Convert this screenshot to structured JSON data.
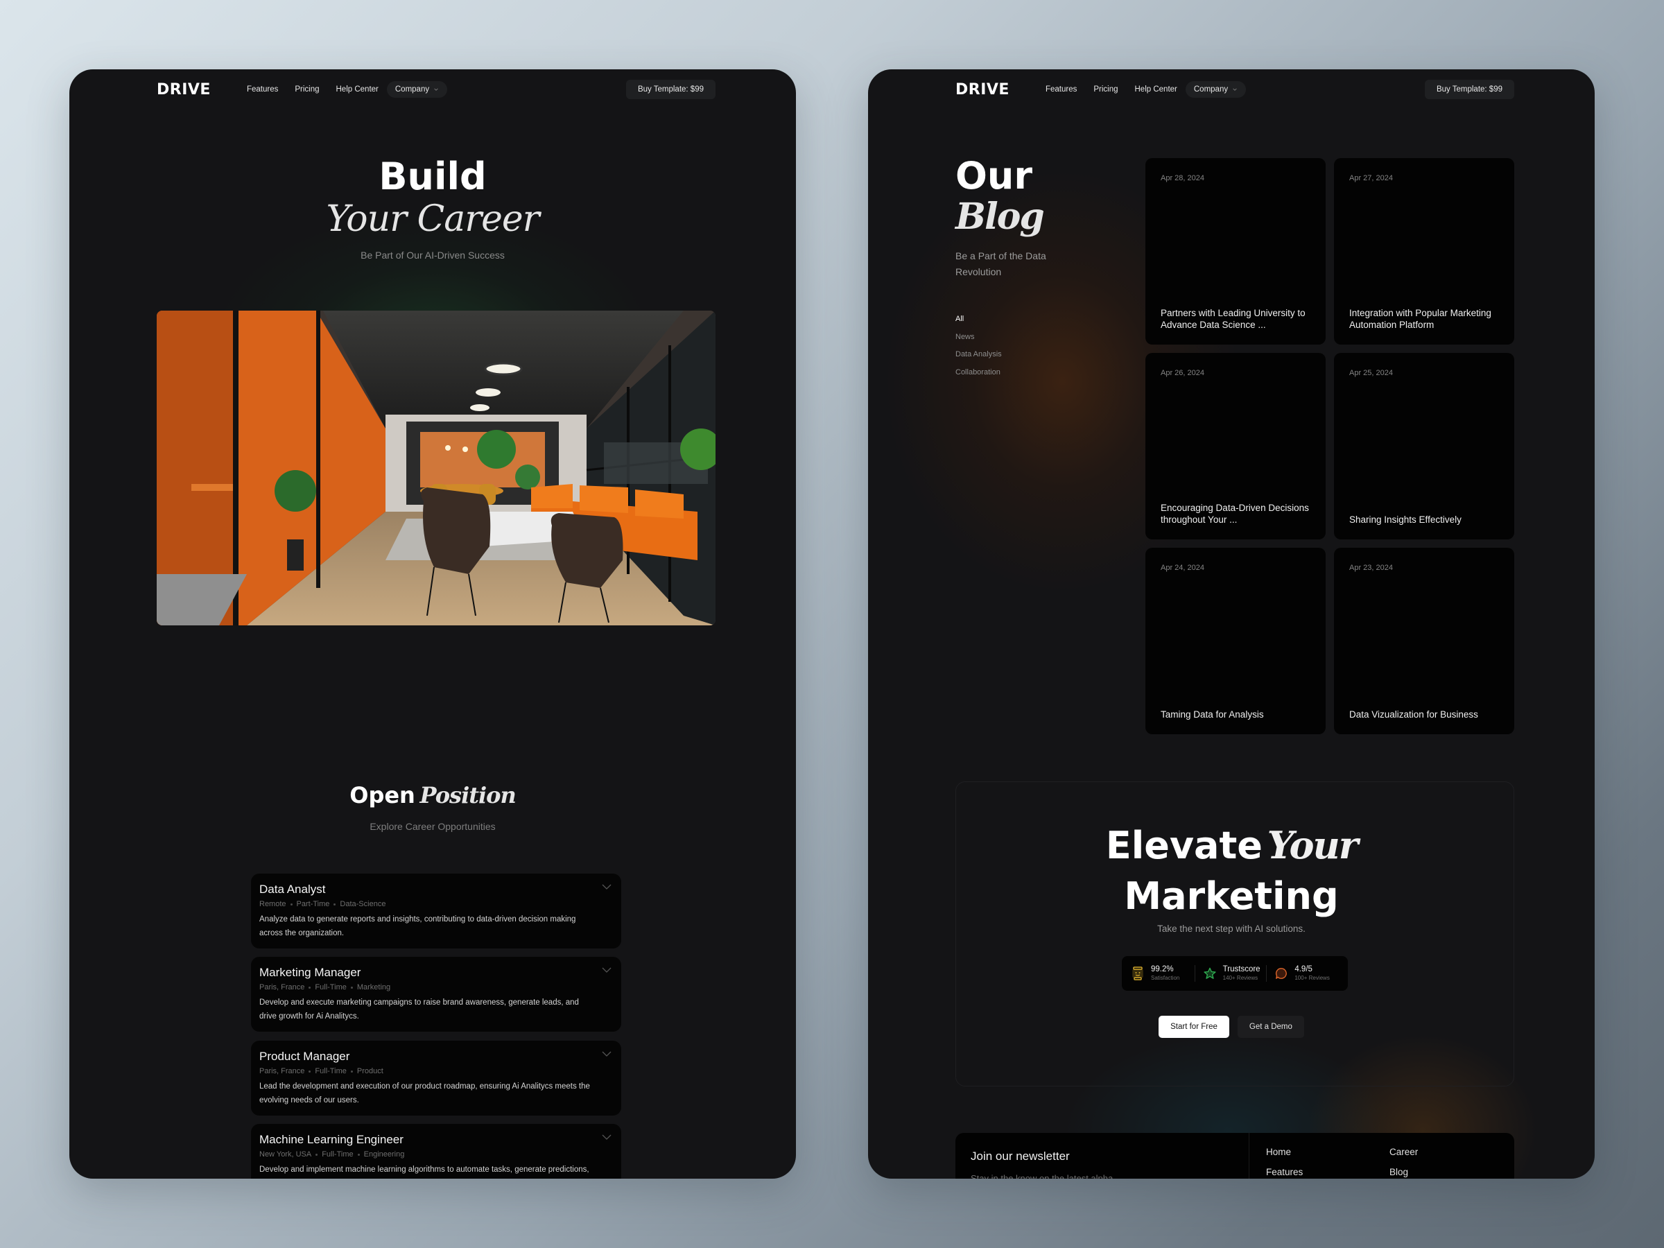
{
  "nav": {
    "logo": "DRIVE",
    "links": [
      "Features",
      "Pricing",
      "Help Center"
    ],
    "company_label": "Company",
    "buy_label": "Buy Template: $99"
  },
  "career": {
    "title_bold": "Build",
    "title_italic": "Your Career",
    "subtitle": "Be Part of Our AI-Driven Success",
    "photo_alt": "Modern office interior with orange sofas and glass walls",
    "positions": {
      "title_bold": "Open",
      "title_italic": "Position",
      "subtitle": "Explore Career Opportunities",
      "jobs": [
        {
          "title": "Data Analyst",
          "location": "Remote",
          "type": "Part-Time",
          "department": "Data-Science",
          "description": "Analyze data to generate reports and insights, contributing to data-driven decision making across the organization."
        },
        {
          "title": "Marketing Manager",
          "location": "Paris, France",
          "type": "Full-Time",
          "department": "Marketing",
          "description": "Develop and execute marketing campaigns to raise brand awareness, generate leads, and drive growth for Ai Analitycs."
        },
        {
          "title": "Product Manager",
          "location": "Paris, France",
          "type": "Full-Time",
          "department": "Product",
          "description": "Lead the development and execution of our product roadmap, ensuring Ai Analitycs meets the evolving needs of our users."
        },
        {
          "title": "Machine Learning Engineer",
          "location": "New York, USA",
          "type": "Full-Time",
          "department": "Engineering",
          "description": "Develop and implement machine learning algorithms to automate tasks, generate predictions, and extract deeper meaning from data."
        }
      ]
    }
  },
  "blog": {
    "title_bold": "Our",
    "title_italic": "Blog",
    "subtitle": "Be a Part of the Data Revolution",
    "filters": [
      {
        "label": "All",
        "active": true
      },
      {
        "label": "News",
        "active": false
      },
      {
        "label": "Data Analysis",
        "active": false
      },
      {
        "label": "Collaboration",
        "active": false
      }
    ],
    "posts": [
      {
        "date": "Apr 28, 2024",
        "title": "Partners with Leading University to Advance Data Science ..."
      },
      {
        "date": "Apr 27, 2024",
        "title": "Integration with Popular Marketing Automation Platform"
      },
      {
        "date": "Apr 26, 2024",
        "title": "Encouraging Data-Driven Decisions throughout Your ..."
      },
      {
        "date": "Apr 25, 2024",
        "title": "Sharing Insights Effectively"
      },
      {
        "date": "Apr 24, 2024",
        "title": "Taming Data for Analysis"
      },
      {
        "date": "Apr 23, 2024",
        "title": "Data Vizualization for Business"
      }
    ]
  },
  "cta": {
    "title_bold_1": "Elevate",
    "title_italic": "Your",
    "title_bold_2": "Marketing",
    "subtitle": "Take the next step with AI solutions.",
    "stats": [
      {
        "icon": "robot-icon",
        "value": "99.2%",
        "label": "Satisfaction",
        "color": "#d4a92b"
      },
      {
        "icon": "star-icon",
        "value": "Trustscore",
        "label": "140+ Reviews",
        "color": "#2fae52"
      },
      {
        "icon": "chat-bubble-icon",
        "value": "4.9/5",
        "label": "100+ Reviews",
        "color": "#e0662a"
      }
    ],
    "primary_button": "Start for Free",
    "secondary_button": "Get a Demo"
  },
  "footer": {
    "newsletter_title": "Join our newsletter",
    "newsletter_sub": "Stay in the know on the latest alpha",
    "links": [
      "Home",
      "Career",
      "Features",
      "Blog"
    ]
  }
}
